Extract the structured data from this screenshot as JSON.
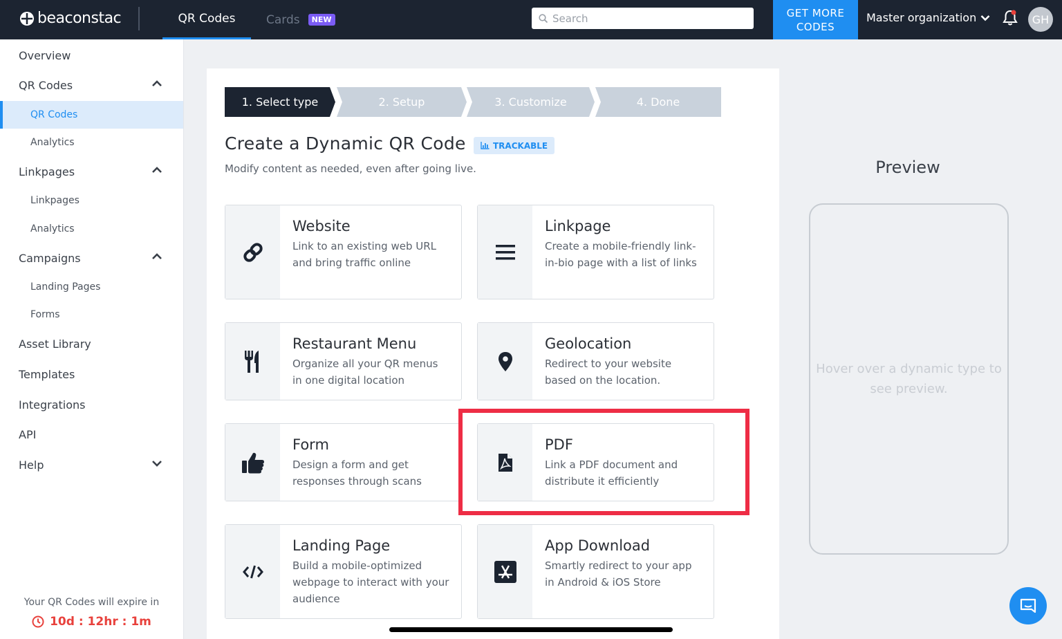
{
  "header": {
    "logo_text": "beaconstac",
    "tabs": [
      {
        "label": "QR Codes"
      },
      {
        "label": "Cards",
        "badge": "NEW"
      }
    ],
    "search_placeholder": "Search",
    "get_more_label": "GET MORE CODES",
    "org_label": "Master organization",
    "avatar_initials": "GH"
  },
  "sidebar": {
    "items": [
      {
        "label": "Overview"
      },
      {
        "label": "QR Codes"
      },
      {
        "label": "QR Codes"
      },
      {
        "label": "Analytics"
      },
      {
        "label": "Linkpages"
      },
      {
        "label": "Linkpages"
      },
      {
        "label": "Analytics"
      },
      {
        "label": "Campaigns"
      },
      {
        "label": "Landing Pages"
      },
      {
        "label": "Forms"
      },
      {
        "label": "Asset Library"
      },
      {
        "label": "Templates"
      },
      {
        "label": "Integrations"
      },
      {
        "label": "API"
      },
      {
        "label": "Help"
      }
    ],
    "expire_text": "Your QR Codes will expire in",
    "timer": "10d : 12hr : 1m"
  },
  "wizard": {
    "steps": [
      "1. Select type",
      "2. Setup",
      "3. Customize",
      "4. Done"
    ],
    "title": "Create a Dynamic QR Code",
    "badge": "TRACKABLE",
    "subtitle": "Modify content as needed, even after going live."
  },
  "tiles": [
    {
      "title": "Website",
      "desc": "Link to an existing web URL and bring traffic online",
      "icon": "link-icon"
    },
    {
      "title": "Linkpage",
      "desc": "Create a mobile-friendly link-in-bio page with a list of links",
      "icon": "list-icon"
    },
    {
      "title": "Restaurant Menu",
      "desc": "Organize all your QR menus in one digital location",
      "icon": "utensils-icon"
    },
    {
      "title": "Geolocation",
      "desc": "Redirect to your website based on the location.",
      "icon": "map-pin-icon"
    },
    {
      "title": "Form",
      "desc": "Design a form and get responses through scans",
      "icon": "thumbs-up-icon"
    },
    {
      "title": "PDF",
      "desc": "Link a PDF document and distribute it efficiently",
      "icon": "pdf-icon"
    },
    {
      "title": "Landing Page",
      "desc": "Build a mobile-optimized webpage to interact with your audience",
      "icon": "code-icon"
    },
    {
      "title": "App Download",
      "desc": "Smartly redirect to your app in Android & iOS Store",
      "icon": "app-store-icon"
    }
  ],
  "preview": {
    "title": "Preview",
    "hint": "Hover over a dynamic type to see preview."
  },
  "colors": {
    "topbar": "#1c2431",
    "accent": "#1f8ef1",
    "highlight": "#ee2d45",
    "badge_new": "#7b5cf5",
    "timer": "#e8413c"
  }
}
